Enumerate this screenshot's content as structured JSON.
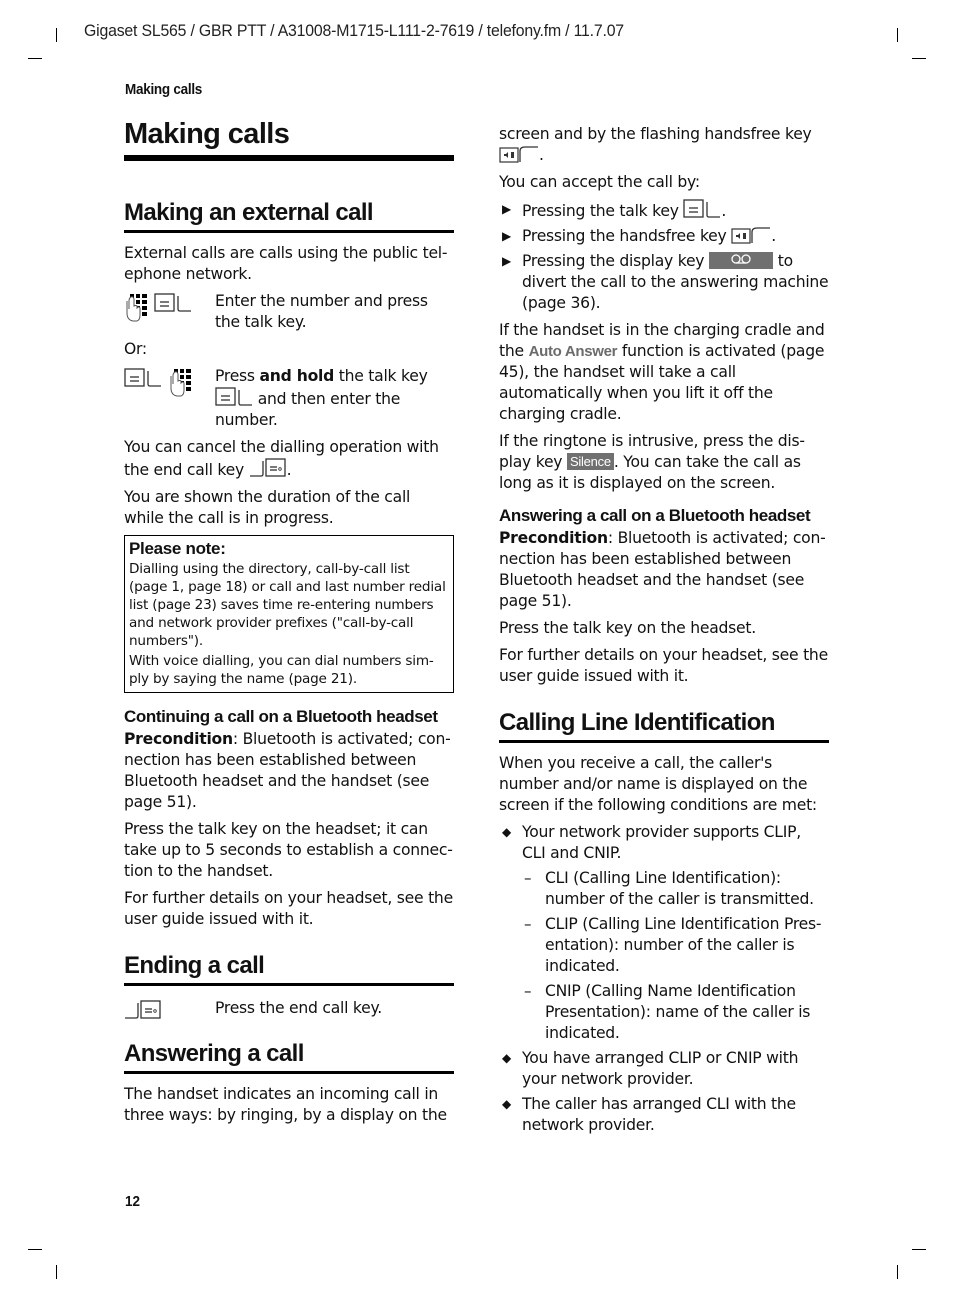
{
  "header": {
    "meta_line": "Gigaset SL565 / GBR PTT / A31008-M1715-L111-2-7619 / telefony.fm / 11.7.07",
    "running_head": "Making calls"
  },
  "footer": {
    "page_number": "12"
  },
  "left": {
    "title": "Making calls",
    "external": {
      "heading": "Making an external call",
      "intro": "External calls are calls using the public tel-ephone network.",
      "step1": "Enter the number and press the talk key.",
      "or": "Or:",
      "step2_pre": "Press ",
      "step2_bold": "and hold",
      "step2_mid": " the talk key",
      "step2_post": " and then enter the number.",
      "cancel_pre": "You can cancel the dialling operation with the end call key",
      "cancel_post": ".",
      "duration": "You are shown the duration of the call while the call is in progress."
    },
    "note": {
      "title": "Please note:",
      "para1": "Dialling using the directory, call-by-call list (page 1, page 18) or call and last number redial list (page 23) saves time re-entering numbers and network provider prefixes (\"call-by-call numbers\").",
      "para2": "With voice dialling, you can dial numbers sim-ply by saying the name (page 21)."
    },
    "bluetooth_continue": {
      "heading": "Continuing a call on a Bluetooth headset",
      "precondition_label": "Precondition",
      "precondition_text": ": Bluetooth is activated; con-nection has been established between Bluetooth headset and the handset (see page 51).",
      "para1": "Press the talk key on the headset; it can take up to 5 seconds to establish a connec-tion to the handset.",
      "para2": "For further details on your headset, see the user guide issued with it."
    },
    "ending": {
      "heading": "Ending a call",
      "step": "Press the end call key."
    },
    "answering": {
      "heading": "Answering a call",
      "intro": "The handset indicates an incoming call in three ways: by ringing, by a display on the"
    }
  },
  "right": {
    "cont_pre": "screen and by the flashing handsfree key",
    "cont_post": ".",
    "accept_intro": "You can accept the call by:",
    "accept_items": [
      {
        "text": "Pressing the talk key",
        "post": "."
      },
      {
        "text": "Pressing the handsfree key",
        "post": "."
      },
      {
        "text": "Pressing the display key",
        "post": " to divert the call to the answering machine (page 36)."
      }
    ],
    "auto_pre": "If the handset is in the charging cradle and the ",
    "auto_term": "Auto Answer",
    "auto_post": " function is activated (page 45), the handset will take a call automatically when you lift it off the charging cradle.",
    "silence_pre": "If the ringtone is intrusive, press the dis-play key ",
    "silence_key": "Silence",
    "silence_post": ". You can take the call as long as it is displayed on the screen.",
    "bluetooth_answer": {
      "heading": "Answering a call on a Bluetooth headset",
      "precondition_label": "Precondition",
      "precondition_text": ": Bluetooth is activated; con-nection has been established between Bluetooth headset and the handset (see page 51).",
      "para1": "Press the talk key on the headset.",
      "para2": "For further details on your headset, see the user guide issued with it."
    },
    "cli": {
      "heading": "Calling Line Identification",
      "intro": "When you receive a call, the caller's number and/or name is displayed on the screen if the following conditions are met:",
      "cond1": "Your network provider supports CLIP, CLI and CNIP.",
      "sub": [
        "CLI (Calling Line Identification): number of the caller is transmitted.",
        "CLIP (Calling Line Identification Pres-entation): number of the caller is indicated.",
        "CNIP (Calling Name Identification Presentation): name of the caller is indicated."
      ],
      "cond2": "You have arranged CLIP or CNIP with your network provider.",
      "cond3": "The caller has arranged CLI with the network provider."
    }
  },
  "glyphs": {
    "triangle": "▶",
    "diamond": "◆",
    "dash": "–"
  }
}
